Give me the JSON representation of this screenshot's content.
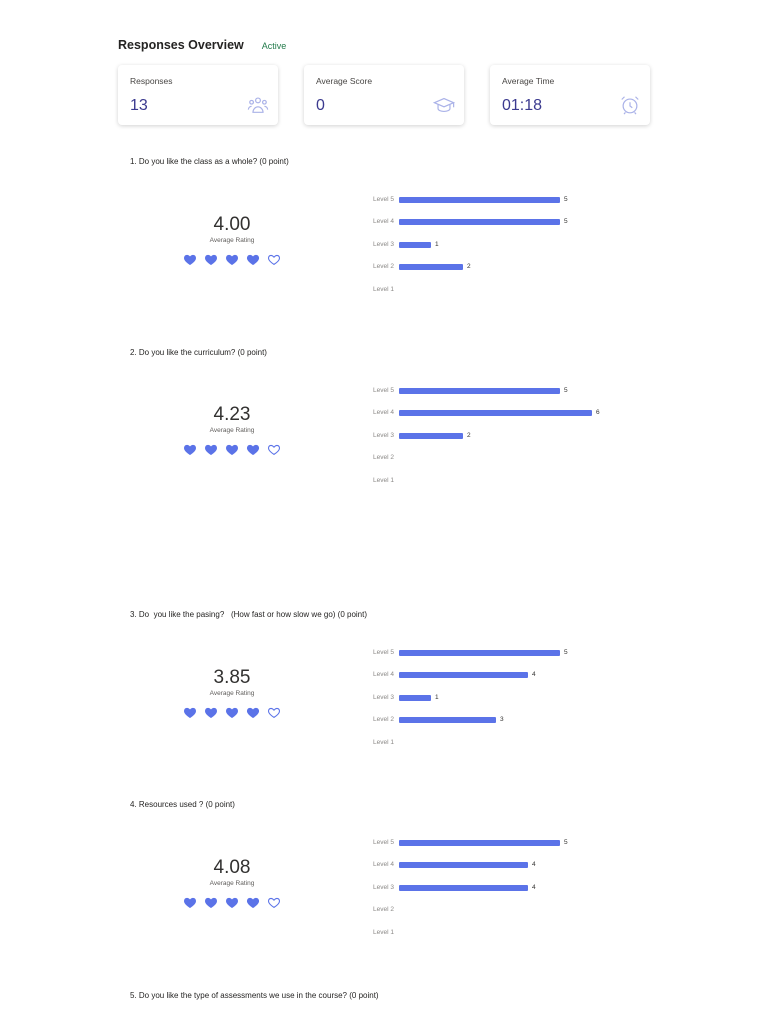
{
  "header": {
    "title": "Responses Overview",
    "status": "Active"
  },
  "stats": [
    {
      "label": "Responses",
      "value": "13",
      "icon": "responders-icon"
    },
    {
      "label": "Average Score",
      "value": "0",
      "icon": "graduation-cap-icon"
    },
    {
      "label": "Average Time",
      "value": "01:18",
      "icon": "alarm-clock-icon"
    }
  ],
  "accent_color": "#5b73e8",
  "questions": [
    {
      "title": "1. Do you like the class as a whole? (0 point)",
      "average": "4.00",
      "average_label": "Average Rating",
      "hearts_filled": 4,
      "levels": [
        {
          "label": "Level 5",
          "count": 5
        },
        {
          "label": "Level 4",
          "count": 5
        },
        {
          "label": "Level 3",
          "count": 1
        },
        {
          "label": "Level 2",
          "count": 2
        },
        {
          "label": "Level 1",
          "count": 0
        }
      ]
    },
    {
      "title": "2. Do you like the curriculum? (0 point)",
      "average": "4.23",
      "average_label": "Average Rating",
      "hearts_filled": 4,
      "levels": [
        {
          "label": "Level 5",
          "count": 5
        },
        {
          "label": "Level 4",
          "count": 6
        },
        {
          "label": "Level 3",
          "count": 2
        },
        {
          "label": "Level 2",
          "count": 0
        },
        {
          "label": "Level 1",
          "count": 0
        }
      ]
    },
    {
      "title": "3. Do  you like the pasing?   (How fast or how slow we go) (0 point)",
      "average": "3.85",
      "average_label": "Average Rating",
      "hearts_filled": 4,
      "levels": [
        {
          "label": "Level 5",
          "count": 5
        },
        {
          "label": "Level 4",
          "count": 4
        },
        {
          "label": "Level 3",
          "count": 1
        },
        {
          "label": "Level 2",
          "count": 3
        },
        {
          "label": "Level 1",
          "count": 0
        }
      ]
    },
    {
      "title": "4. Resources used ? (0 point)",
      "average": "4.08",
      "average_label": "Average Rating",
      "hearts_filled": 4,
      "levels": [
        {
          "label": "Level 5",
          "count": 5
        },
        {
          "label": "Level 4",
          "count": 4
        },
        {
          "label": "Level 3",
          "count": 4
        },
        {
          "label": "Level 2",
          "count": 0
        },
        {
          "label": "Level 1",
          "count": 0
        }
      ]
    },
    {
      "title": "5. Do you like the type of assessments we use in the course? (0 point)"
    }
  ]
}
